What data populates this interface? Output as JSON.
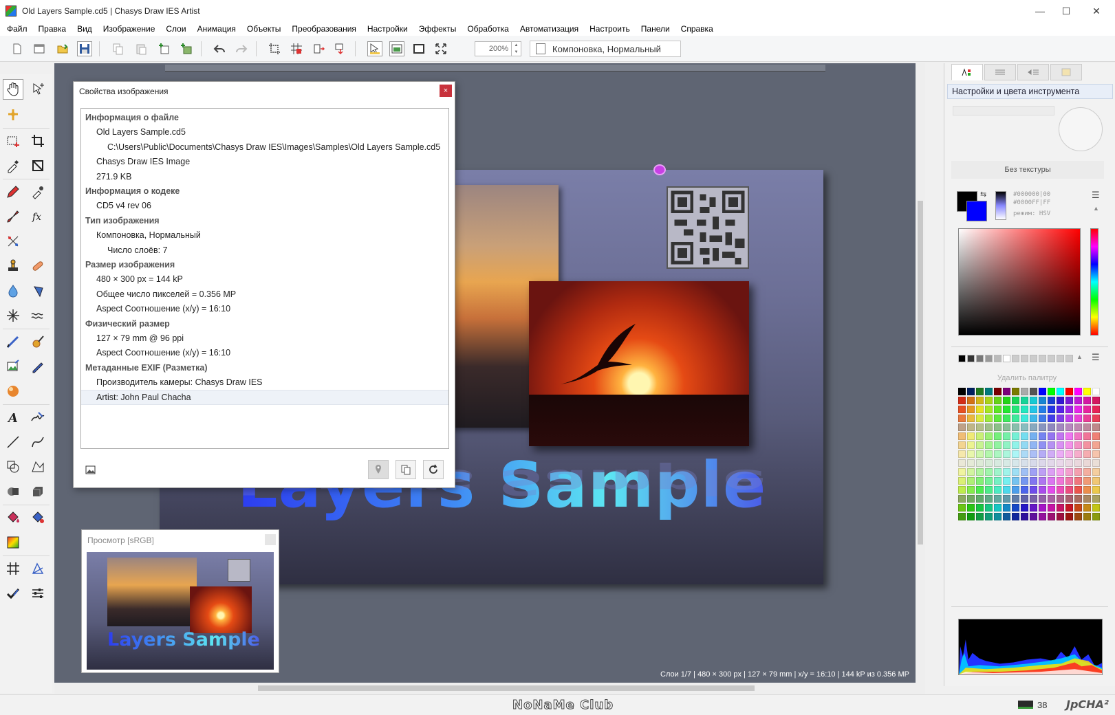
{
  "window": {
    "title": "Old Layers Sample.cd5 | Chasys Draw IES Artist",
    "controls": {
      "minimize": "—",
      "maximize": "☐",
      "close": "✕"
    }
  },
  "menu": [
    "Файл",
    "Правка",
    "Вид",
    "Изображение",
    "Слои",
    "Анимация",
    "Объекты",
    "Преобразования",
    "Настройки",
    "Эффекты",
    "Обработка",
    "Автоматизация",
    "Настроить",
    "Панели",
    "Справка"
  ],
  "toolbar": {
    "zoom": "200%",
    "mode": "Компоновка, Нормальный",
    "icons": [
      "new-doc-icon",
      "open-icon",
      "open-folder-icon",
      "save-icon",
      "copy-icon",
      "paste-icon",
      "new-layer-icon",
      "duplicate-layer-icon",
      "undo-icon",
      "redo-icon",
      "crop-icon",
      "grid-icon",
      "resize-icon",
      "transform-icon",
      "select-tool-icon",
      "fit-icon",
      "frame-icon",
      "fullscreen-icon"
    ]
  },
  "dialog": {
    "title": "Свойства изображения",
    "close": "×",
    "rows": [
      {
        "level": "h",
        "text": "Информация о файле"
      },
      {
        "level": "l1",
        "text": "Old Layers Sample.cd5"
      },
      {
        "level": "l2",
        "text": "C:\\Users\\Public\\Documents\\Chasys Draw IES\\Images\\Samples\\Old Layers Sample.cd5"
      },
      {
        "level": "l1",
        "text": "Chasys Draw IES Image"
      },
      {
        "level": "l1",
        "text": "271.9 KB"
      },
      {
        "level": "h",
        "text": "Информация о кодеке"
      },
      {
        "level": "l1",
        "text": "CD5 v4 rev 06"
      },
      {
        "level": "h",
        "text": "Тип изображения"
      },
      {
        "level": "l1",
        "text": "Компоновка, Нормальный"
      },
      {
        "level": "l2",
        "text": "Число слоёв: 7"
      },
      {
        "level": "h",
        "text": "Размер изображения"
      },
      {
        "level": "l1",
        "text": "480 × 300 px = 144 kP"
      },
      {
        "level": "l1",
        "text": "Общее число пикселей = 0.356 MP"
      },
      {
        "level": "l1",
        "text": "Aspect Соотношение (x/y) = 16:10"
      },
      {
        "level": "h",
        "text": "Физический размер"
      },
      {
        "level": "l1",
        "text": "127 × 79 mm @ 96 ppi"
      },
      {
        "level": "l1",
        "text": "Aspect Соотношение (x/y) = 16:10"
      },
      {
        "level": "h",
        "text": "Метаданные EXIF (Разметка)"
      },
      {
        "level": "l1",
        "text": "Производитель камеры: Chasys Draw IES"
      },
      {
        "level": "l1",
        "text": "Artist: John Paul Chacha",
        "selected": true
      }
    ]
  },
  "canvas": {
    "image_text": "Layers Sample",
    "status": "Слои 1/7 | 480 × 300 px | 127 × 79 mm | x/y = 16:10 | 144 kP из 0.356 MP"
  },
  "preview": {
    "title": "Просмотр [sRGB]",
    "image_text": "Layers Sample"
  },
  "right_panel": {
    "header": "Настройки и цвета инструмента",
    "texture": "Без текстуры",
    "fg_hex": "#000000|00",
    "bg_hex": "#0000FF|FF",
    "mode": "режим: HSV",
    "delete_palette": "Удалить палитру",
    "fg_color": "#000000",
    "bg_color": "#0000FF"
  },
  "bottom": {
    "brand": "NoNaMe Club",
    "memory": "38",
    "logo": "JpCHA²"
  }
}
